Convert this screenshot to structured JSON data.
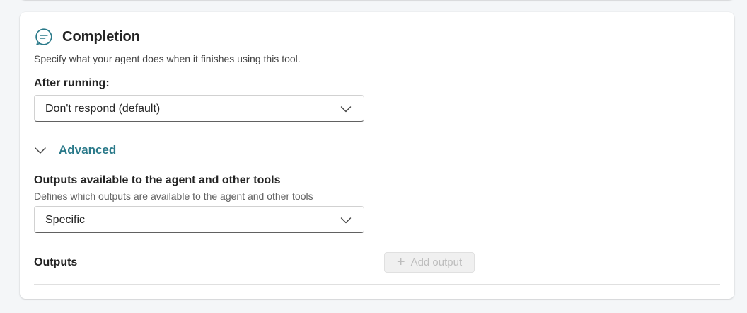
{
  "completion": {
    "icon": "chat-bubble-icon",
    "title": "Completion",
    "description": "Specify what your agent does when it finishes using this tool.",
    "after_running": {
      "label": "After running:",
      "selected": "Don't respond (default)"
    },
    "advanced": {
      "label": "Advanced",
      "expanded": true
    },
    "outputs_available": {
      "label": "Outputs available to the agent and other tools",
      "description": "Defines which outputs are available to the agent and other tools",
      "selected": "Specific"
    },
    "outputs": {
      "label": "Outputs",
      "add_button_label": "Add output",
      "add_button_disabled": true
    }
  },
  "colors": {
    "accent": "#2b7a8a",
    "page_background": "#f4f6f8",
    "card_background": "#ffffff",
    "disabled_text": "#bdbdbd"
  }
}
